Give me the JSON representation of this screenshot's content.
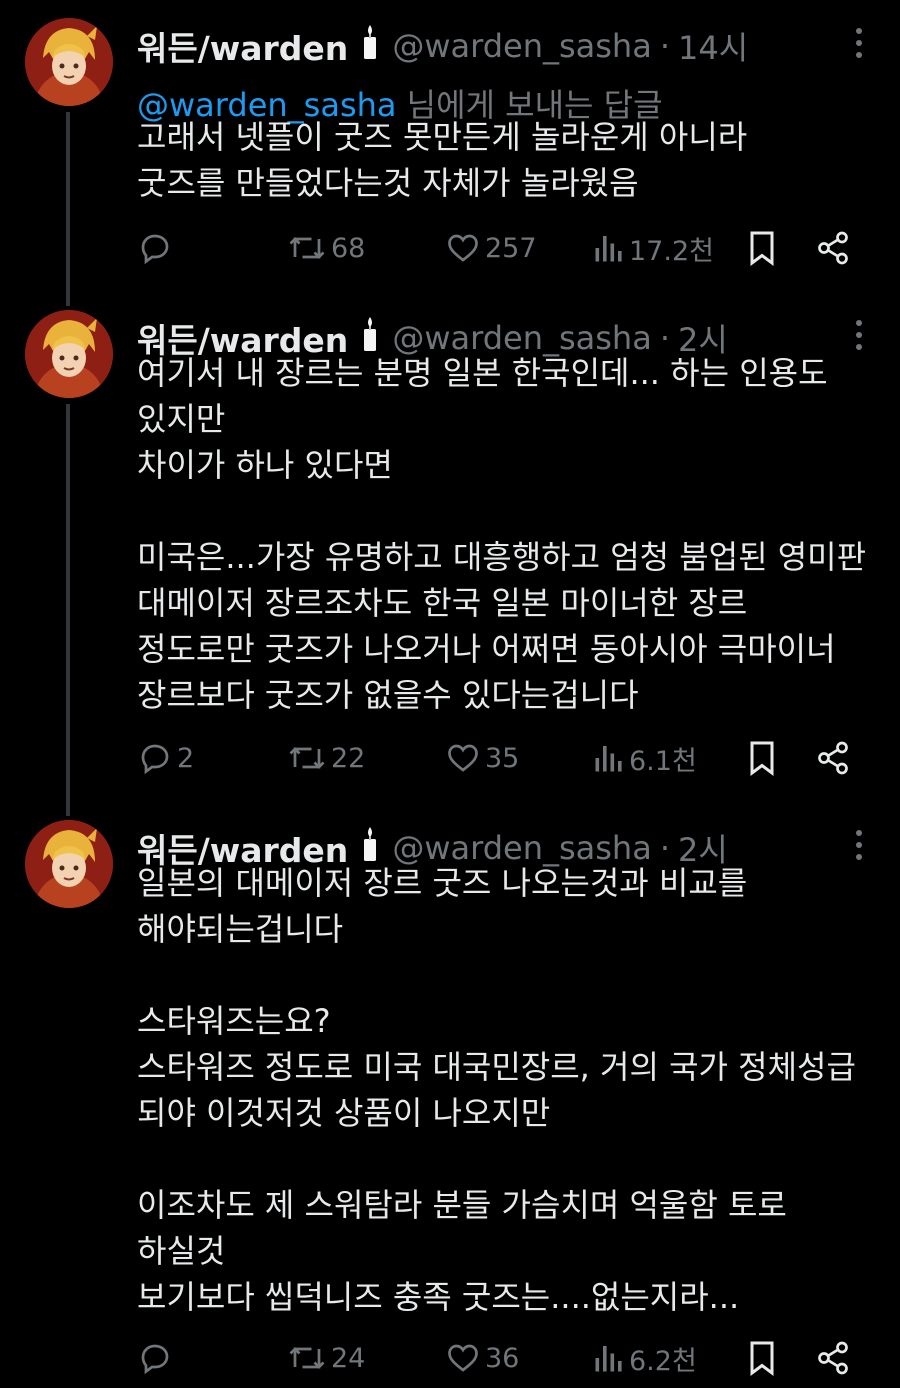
{
  "colors": {
    "background": "#000000",
    "text": "#e7e9ea",
    "muted": "#71767b",
    "mention": "#1d9bf0",
    "thread_line": "#333639"
  },
  "tweets": [
    {
      "display_name": "워든/warden",
      "handle": "@warden_sasha",
      "separator": "·",
      "time": "14시",
      "replying_to": {
        "mention": "@warden_sasha",
        "suffix": " 님에게 보내는 답글"
      },
      "lines": [
        "고래서 넷플이 굿즈 못만든게 놀라운게 아니라",
        "굿즈를 만들었다는것 자체가 놀라웠음"
      ],
      "reply_count": "",
      "retweet_count": "68",
      "like_count": "257",
      "view_count": "17.2천"
    },
    {
      "display_name": "워든/warden",
      "handle": "@warden_sasha",
      "separator": "·",
      "time": "2시",
      "lines": [
        "여기서 내 장르는 분명 일본 한국인데... 하는 인용도",
        "있지만",
        "차이가 하나 있다면",
        "",
        "미국은...가장 유명하고 대흥행하고 엄청 붐업된 영미판",
        "대메이저 장르조차도 한국 일본 마이너한 장르",
        "정도로만 굿즈가 나오거나 어쩌면 동아시아 극마이너",
        "장르보다 굿즈가 없을수 있다는겁니다"
      ],
      "reply_count": "2",
      "retweet_count": "22",
      "like_count": "35",
      "view_count": "6.1천"
    },
    {
      "display_name": "워든/warden",
      "handle": "@warden_sasha",
      "separator": "·",
      "time": "2시",
      "lines": [
        "일본의 대메이저 장르 굿즈 나오는것과 비교를",
        "해야되는겁니다",
        "",
        "스타워즈는요?",
        "스타워즈 정도로 미국 대국민장르, 거의 국가 정체성급",
        "되야 이것저것 상품이 나오지만",
        "",
        "이조차도 제 스워탐라 분들 가슴치며 억울함 토로",
        "하실것",
        "보기보다 씹덕니즈 충족 굿즈는....없는지라..."
      ],
      "reply_count": "",
      "retweet_count": "24",
      "like_count": "36",
      "view_count": "6.2천"
    }
  ],
  "icons": [
    "candle-icon",
    "more-icon",
    "reply-icon",
    "retweet-icon",
    "like-icon",
    "views-icon",
    "bookmark-icon",
    "share-icon"
  ]
}
